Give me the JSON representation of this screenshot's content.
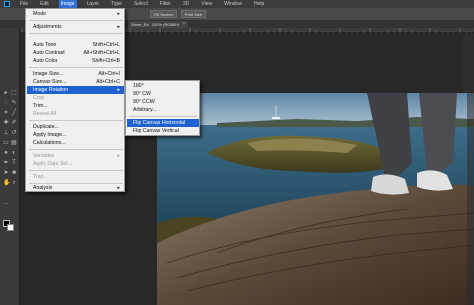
{
  "menubar": {
    "items": [
      {
        "label": "File"
      },
      {
        "label": "Edit"
      },
      {
        "label": "Image",
        "active": true
      },
      {
        "label": "Layer"
      },
      {
        "label": "Type"
      },
      {
        "label": "Select"
      },
      {
        "label": "Filter"
      },
      {
        "label": "3D"
      },
      {
        "label": "View"
      },
      {
        "label": "Window"
      },
      {
        "label": "Help"
      }
    ]
  },
  "optionsbar": {
    "buttons": [
      "Fill Screen",
      "Print Size"
    ]
  },
  "document_tab": {
    "name": "Stone_Ru",
    "info": "100% (RGB/8*)",
    "close": "×"
  },
  "image_menu": {
    "items": [
      {
        "label": "Mode",
        "shortcut": "",
        "submenu": true,
        "disabled": false
      },
      {
        "label": "Adjustments",
        "shortcut": "",
        "submenu": true,
        "disabled": false
      },
      {
        "label": "Auto Tone",
        "shortcut": "Shift+Ctrl+L",
        "submenu": false,
        "disabled": false
      },
      {
        "label": "Auto Contrast",
        "shortcut": "Alt+Shift+Ctrl+L",
        "submenu": false,
        "disabled": false
      },
      {
        "label": "Auto Color",
        "shortcut": "Shift+Ctrl+B",
        "submenu": false,
        "disabled": false
      },
      {
        "label": "Image Size...",
        "shortcut": "Alt+Ctrl+I",
        "submenu": false,
        "disabled": false
      },
      {
        "label": "Canvas Size...",
        "shortcut": "Alt+Ctrl+C",
        "submenu": false,
        "disabled": false
      },
      {
        "label": "Image Rotation",
        "shortcut": "",
        "submenu": true,
        "disabled": false,
        "highlighted": true
      },
      {
        "label": "Crop",
        "shortcut": "",
        "submenu": false,
        "disabled": true
      },
      {
        "label": "Trim...",
        "shortcut": "",
        "submenu": false,
        "disabled": false
      },
      {
        "label": "Reveal All",
        "shortcut": "",
        "submenu": false,
        "disabled": true
      },
      {
        "label": "Duplicate...",
        "shortcut": "",
        "submenu": false,
        "disabled": false
      },
      {
        "label": "Apply Image...",
        "shortcut": "",
        "submenu": false,
        "disabled": false
      },
      {
        "label": "Calculations...",
        "shortcut": "",
        "submenu": false,
        "disabled": false
      },
      {
        "label": "Variables",
        "shortcut": "",
        "submenu": true,
        "disabled": true
      },
      {
        "label": "Apply Data Set...",
        "shortcut": "",
        "submenu": false,
        "disabled": true
      },
      {
        "label": "Trap...",
        "shortcut": "",
        "submenu": false,
        "disabled": true
      },
      {
        "label": "Analysis",
        "shortcut": "",
        "submenu": true,
        "disabled": false
      }
    ]
  },
  "rotation_submenu": {
    "items": [
      {
        "label": "180°"
      },
      {
        "label": "90° CW"
      },
      {
        "label": "90° CCW"
      },
      {
        "label": "Arbitrary..."
      },
      {
        "label": "Flip Canvas Horizontal",
        "highlighted": true
      },
      {
        "label": "Flip Canvas Vertical"
      }
    ]
  },
  "colors": {
    "menu_highlight": "#1e62d0",
    "menu_bg": "#f0f0f0",
    "app_bg": "#282828"
  }
}
